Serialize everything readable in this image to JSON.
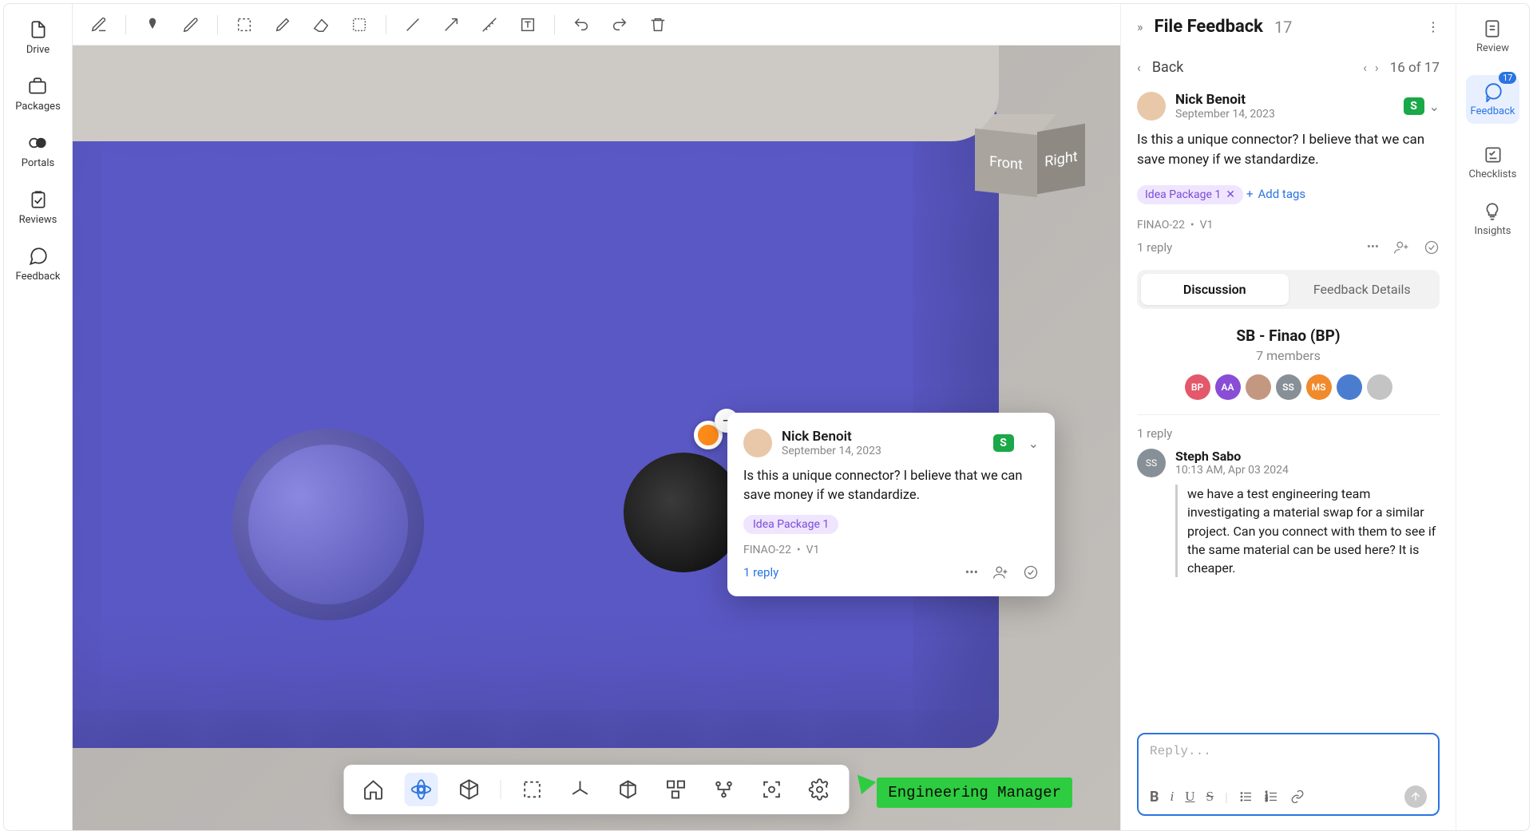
{
  "leftRail": {
    "drive": "Drive",
    "packages": "Packages",
    "portals": "Portals",
    "reviews": "Reviews",
    "feedback": "Feedback"
  },
  "viewcube": {
    "front": "Front",
    "right": "Right"
  },
  "commentCard": {
    "author": "Nick Benoit",
    "date": "September 14, 2023",
    "statusLetter": "S",
    "body": "Is this a unique connector? I believe that we can save money if we standardize.",
    "tag": "Idea Package 1",
    "refId": "FINAO-22",
    "version": "V1",
    "replyCount": "1 reply"
  },
  "cursorLabel": "Engineering Manager",
  "panel": {
    "title": "File Feedback",
    "count": "17",
    "back": "Back",
    "navPos": "16 of 17",
    "fbAuthor": "Nick Benoit",
    "fbDate": "September 14, 2023",
    "fbStatusLetter": "S",
    "fbBody": "Is this a unique connector? I believe that we can save money if we standardize.",
    "fbTag": "Idea Package 1",
    "addTags": "Add tags",
    "fbRef": "FINAO-22",
    "fbVer": "V1",
    "fbReplies": "1 reply",
    "tabDiscussion": "Discussion",
    "tabDetails": "Feedback Details",
    "groupName": "SB - Finao (BP)",
    "groupMembers": "7 members",
    "avatars": [
      "BP",
      "AA",
      "",
      "SS",
      "MS",
      "",
      ""
    ],
    "avatarColors": [
      "#e4586b",
      "#8a4dd6",
      "#c49781",
      "#889097",
      "#f08a2c",
      "#4a7dd0",
      "#c4c4c4"
    ],
    "discReplyCount": "1 reply",
    "replyAuthor": "Steph Sabo",
    "replyAuthorInitials": "SS",
    "replyDate": "10:13 AM, Apr 03 2024",
    "replyText": "we have a test engineering team investigating a material swap for a similar project. Can you connect with them to see if the same material can be used here? It is cheaper.",
    "composePlaceholder": "Reply..."
  },
  "rightRail": {
    "review": "Review",
    "feedback": "Feedback",
    "feedbackBadge": "17",
    "checklists": "Checklists",
    "insights": "Insights"
  }
}
